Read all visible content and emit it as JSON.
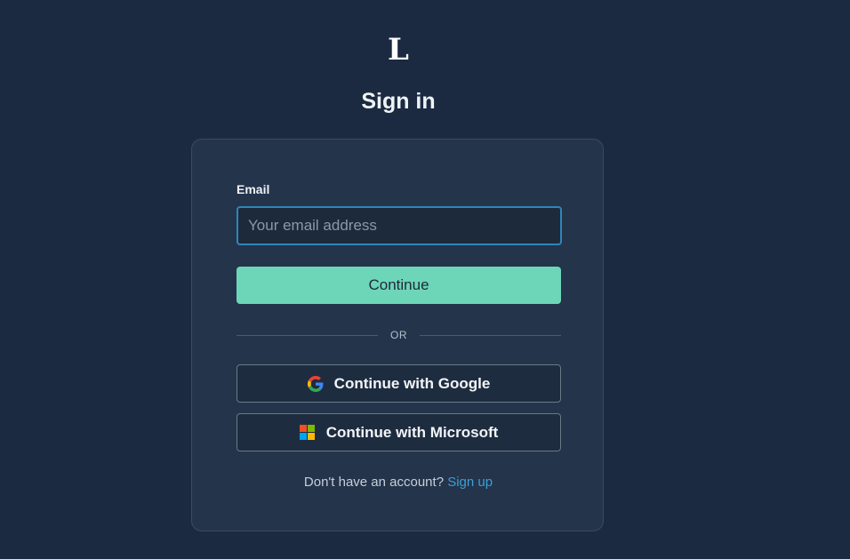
{
  "brand": {
    "logo_text": "L"
  },
  "page": {
    "title": "Sign in"
  },
  "form": {
    "email_label": "Email",
    "email_value": "",
    "email_placeholder": "Your email address",
    "continue_label": "Continue",
    "divider_text": "OR"
  },
  "oauth": {
    "google_label": "Continue with Google",
    "google_icon": "google-g-icon",
    "microsoft_label": "Continue with Microsoft",
    "microsoft_icon": "microsoft-logo-icon"
  },
  "footer": {
    "prompt": "Don't have an account?",
    "signup_label": "Sign up"
  },
  "colors": {
    "background": "#1b2a40",
    "card": "#24344b",
    "primary_button": "#6dd6b8",
    "link": "#3b9fd8",
    "input_focus_border": "#2f86b8"
  }
}
